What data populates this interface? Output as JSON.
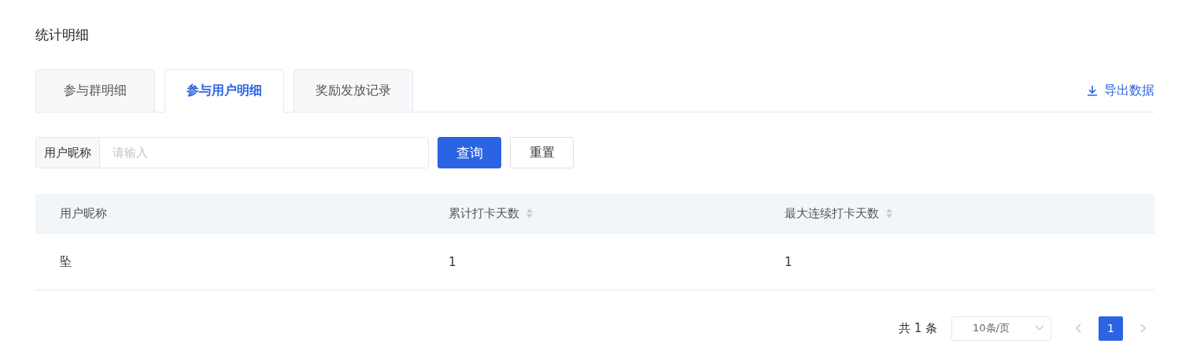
{
  "title": "统计明细",
  "tabs": [
    {
      "label": "参与群明细",
      "selected": false
    },
    {
      "label": "参与用户明细",
      "selected": true
    },
    {
      "label": "奖励发放记录",
      "selected": false
    }
  ],
  "export_button": {
    "label": "导出数据"
  },
  "filter": {
    "label": "用户昵称",
    "placeholder": "请输入",
    "search_button": "查询",
    "reset_button": "重置"
  },
  "table": {
    "columns": [
      {
        "label": "用户昵称",
        "sortable": false
      },
      {
        "label": "累计打卡天数",
        "sortable": true
      },
      {
        "label": "最大连续打卡天数",
        "sortable": true
      }
    ],
    "rows": [
      [
        "坠",
        "1",
        "1"
      ]
    ]
  },
  "pagination": {
    "total": "共 1 条",
    "page_size": "10条/页",
    "prev_disabled": true,
    "next_disabled": true,
    "pages": [
      {
        "label": "1",
        "selected": true
      }
    ]
  }
}
